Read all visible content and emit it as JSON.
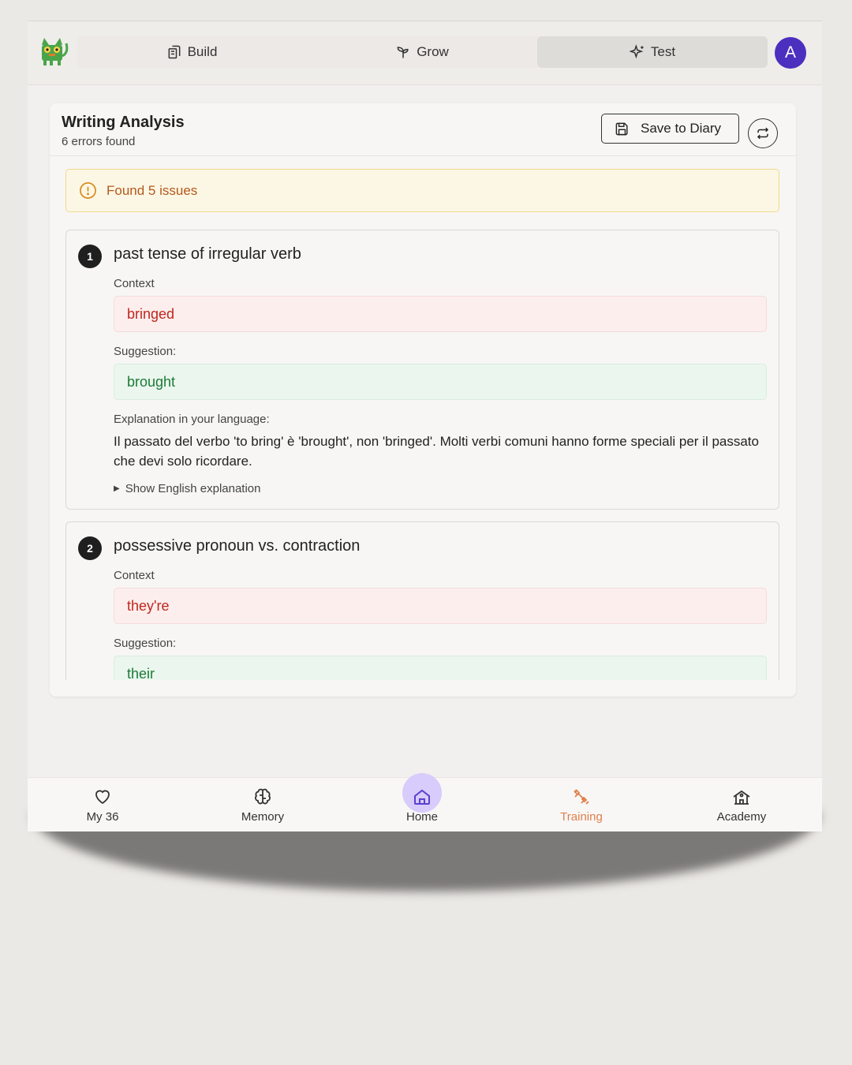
{
  "top_nav": {
    "tabs": [
      {
        "label": "Build",
        "icon": "build-icon"
      },
      {
        "label": "Grow",
        "icon": "sprout-icon"
      },
      {
        "label": "Test",
        "icon": "sparkles-icon",
        "active": true
      }
    ],
    "avatar_initial": "A"
  },
  "analysis": {
    "title": "Writing Analysis",
    "subtitle": "6 errors found",
    "save_label": "Save to Diary",
    "alert_text": "Found 5 issues",
    "issues": [
      {
        "number": "1",
        "title": "past tense of irregular verb",
        "context_label": "Context",
        "context": "bringed",
        "suggestion_label": "Suggestion:",
        "suggestion": "brought",
        "explanation_label": "Explanation in your language:",
        "explanation": "Il passato del verbo 'to bring' è 'brought', non 'bringed'. Molti verbi comuni hanno forme speciali per il passato che devi solo ricordare.",
        "toggle_label": "Show English explanation"
      },
      {
        "number": "2",
        "title": "possessive pronoun vs. contraction",
        "context_label": "Context",
        "context": "they're",
        "suggestion_label": "Suggestion:",
        "suggestion": "their"
      }
    ]
  },
  "bottom_nav": [
    {
      "label": "My 36",
      "icon": "heart-icon"
    },
    {
      "label": "Memory",
      "icon": "brain-icon"
    },
    {
      "label": "Home",
      "icon": "home-icon",
      "active": true
    },
    {
      "label": "Training",
      "icon": "dumbbell-icon"
    },
    {
      "label": "Academy",
      "icon": "school-icon"
    }
  ],
  "colors": {
    "accent": "#4b2fbf",
    "home_highlight": "#d7ccfb",
    "training": "#e07f4a",
    "error_text": "#c0271d",
    "suggestion_text": "#1d7a36",
    "alert_text": "#b4581b"
  }
}
